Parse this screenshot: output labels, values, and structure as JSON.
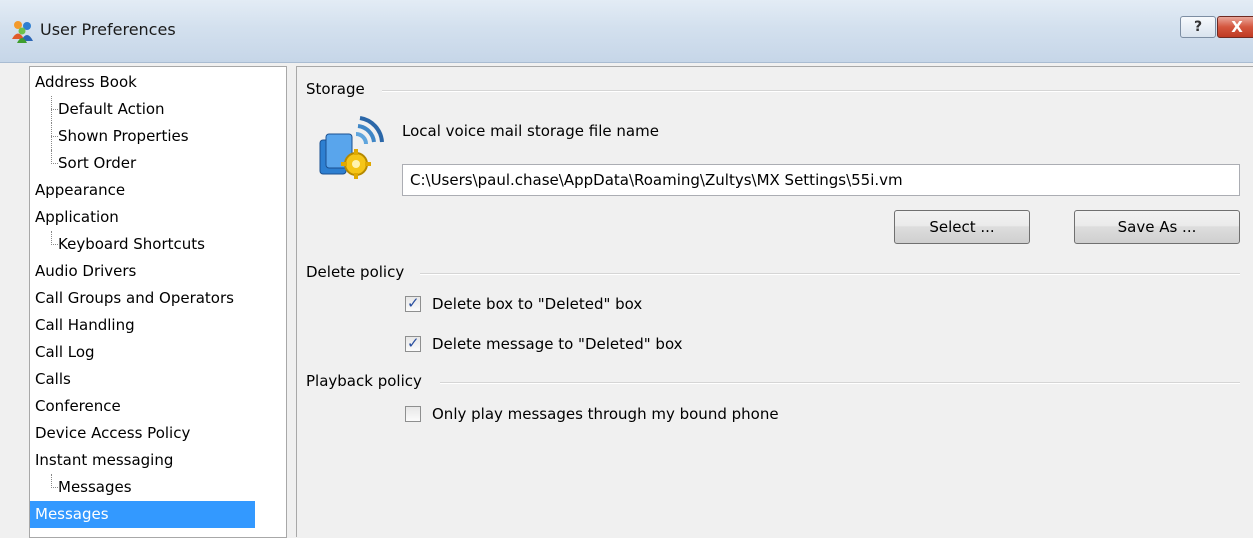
{
  "window": {
    "title": "User Preferences",
    "help_label": "?",
    "close_label": "X"
  },
  "tree": {
    "items": [
      {
        "label": "Address Book",
        "level": 0
      },
      {
        "label": "Default Action",
        "level": 1
      },
      {
        "label": "Shown Properties",
        "level": 1
      },
      {
        "label": "Sort Order",
        "level": 1
      },
      {
        "label": "Appearance",
        "level": 0
      },
      {
        "label": "Application",
        "level": 0
      },
      {
        "label": "Keyboard Shortcuts",
        "level": 1
      },
      {
        "label": "Audio Drivers",
        "level": 0
      },
      {
        "label": "Call Groups and Operators",
        "level": 0
      },
      {
        "label": "Call Handling",
        "level": 0
      },
      {
        "label": "Call Log",
        "level": 0
      },
      {
        "label": "Calls",
        "level": 0
      },
      {
        "label": "Conference",
        "level": 0
      },
      {
        "label": "Device Access Policy",
        "level": 0
      },
      {
        "label": "Instant messaging",
        "level": 0
      },
      {
        "label": "Messages",
        "level": 1
      },
      {
        "label": "Messages",
        "level": 0,
        "selected": true
      }
    ]
  },
  "storage": {
    "group_title": "Storage",
    "file_label": "Local voice mail storage file name",
    "file_value": "C:\\Users\\paul.chase\\AppData\\Roaming\\Zultys\\MX Settings\\55i.vm",
    "select_label": "Select ...",
    "save_as_label": "Save As ..."
  },
  "delete_policy": {
    "group_title": "Delete policy",
    "delete_box_label": "Delete box to \"Deleted\" box",
    "delete_box_checked": true,
    "delete_message_label": "Delete message to \"Deleted\" box",
    "delete_message_checked": true
  },
  "playback_policy": {
    "group_title": "Playback policy",
    "bound_phone_label": "Only play messages through my bound phone",
    "bound_phone_checked": false
  },
  "icons": {
    "app": "users-icon",
    "storage": "voicemail-gear-icon",
    "check": "checkmark-icon"
  },
  "colors": {
    "selection": "#3399ff",
    "close_button": "#c9462f"
  }
}
